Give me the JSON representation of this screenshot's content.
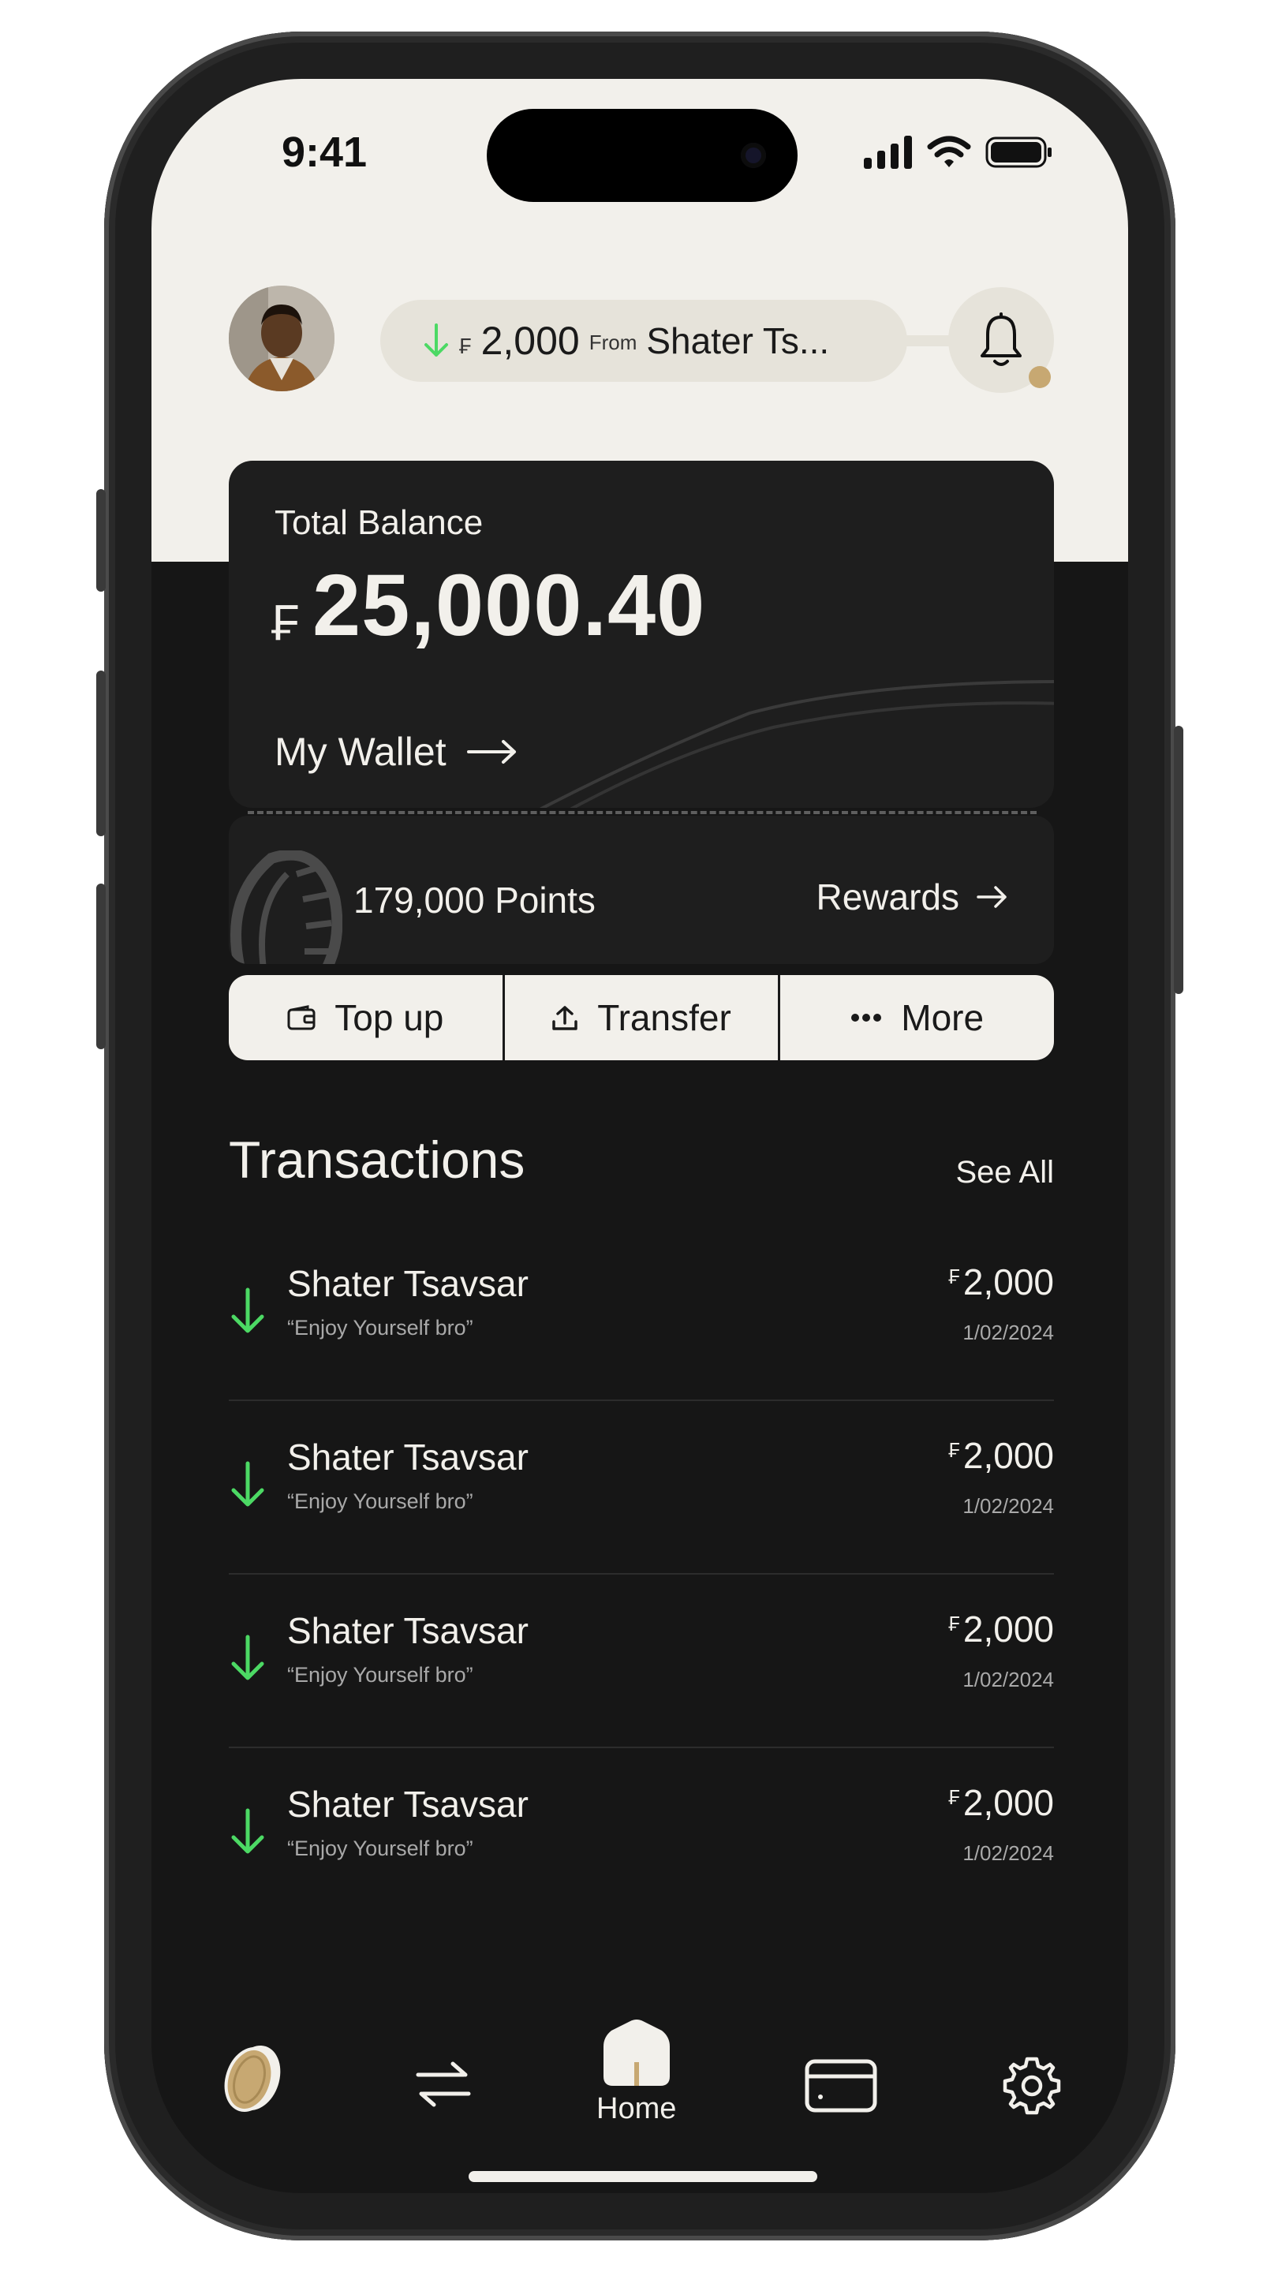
{
  "status_bar": {
    "time": "9:41"
  },
  "header": {
    "notification": {
      "currency": "₣",
      "amount": "2,000",
      "from_label": "From",
      "sender": "Shater Ts..."
    }
  },
  "balance": {
    "label": "Total Balance",
    "currency": "₣",
    "amount": "25,000.40",
    "wallet_link": "My Wallet"
  },
  "points": {
    "value": "179,000",
    "unit": "Points",
    "rewards_label": "Rewards"
  },
  "actions": [
    {
      "label": "Top up",
      "icon": "wallet-icon"
    },
    {
      "label": "Transfer",
      "icon": "upload-icon"
    },
    {
      "label": "More",
      "icon": "more-dots-icon"
    }
  ],
  "transactions": {
    "title": "Transactions",
    "see_all": "See All",
    "items": [
      {
        "name": "Shater Tsavsar",
        "note": "“Enjoy Yourself bro”",
        "currency": "₣",
        "amount": "2,000",
        "date": "1/02/2024"
      },
      {
        "name": "Shater Tsavsar",
        "note": "“Enjoy Yourself bro”",
        "currency": "₣",
        "amount": "2,000",
        "date": "1/02/2024"
      },
      {
        "name": "Shater Tsavsar",
        "note": "“Enjoy Yourself bro”",
        "currency": "₣",
        "amount": "2,000",
        "date": "1/02/2024"
      },
      {
        "name": "Shater Tsavsar",
        "note": "“Enjoy Yourself bro”",
        "currency": "₣",
        "amount": "2,000",
        "date": "1/02/2024"
      }
    ]
  },
  "nav": {
    "items": [
      {
        "icon": "coin-icon"
      },
      {
        "icon": "transfer-arrows-icon"
      },
      {
        "icon": "home-icon",
        "label": "Home",
        "active": true
      },
      {
        "icon": "card-icon"
      },
      {
        "icon": "settings-gear-icon"
      }
    ]
  },
  "colors": {
    "background_dark": "#161616",
    "background_light": "#f2f0eb",
    "card": "#1e1e1e",
    "incoming_green": "#4cd964",
    "accent_gold": "#c7a872"
  }
}
